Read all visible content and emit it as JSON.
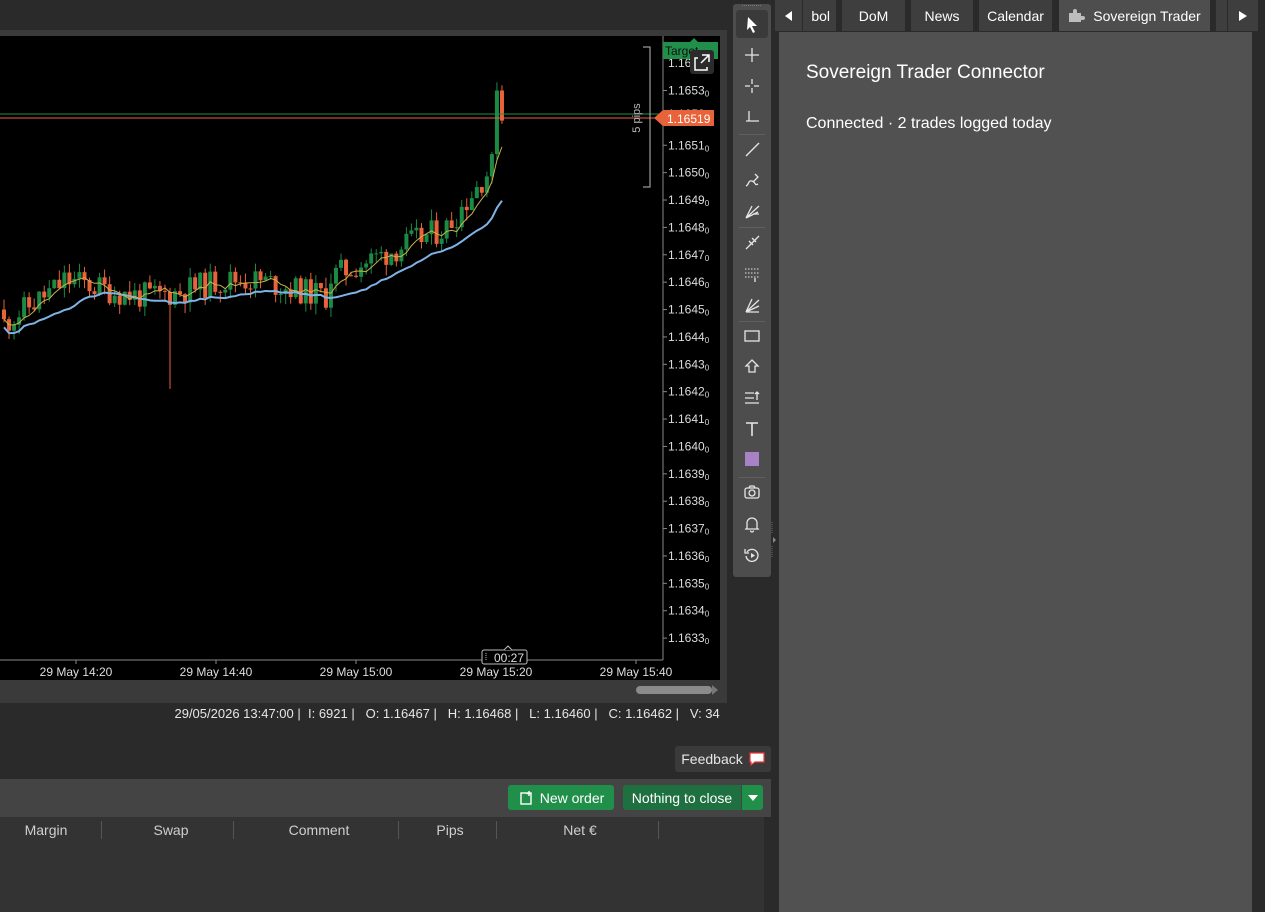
{
  "chart": {
    "price_labels": [
      "1.1653",
      "1.1652",
      "1.1651",
      "1.1650",
      "1.1649",
      "1.1648",
      "1.1647",
      "1.1646",
      "1.1645",
      "1.1644",
      "1.1643",
      "1.1642",
      "1.1641",
      "1.1640",
      "1.1639",
      "1.1638",
      "1.1637",
      "1.1636",
      "1.1635",
      "1.1634",
      "1.1633"
    ],
    "price_label_suffix": "0",
    "time_labels": [
      "29 May 14:20",
      "29 May 14:40",
      "29 May 15:00",
      "29 May 15:20",
      "29 May 15:40"
    ],
    "current_price": "1.16519",
    "target_label": "Target",
    "target_price_partial": "1.1652",
    "top_price_partial": "1.165",
    "range_label": "5 pips",
    "countdown": "00:27",
    "colors": {
      "bull": "#1b8a44",
      "bear": "#e8623a",
      "ma_fast": "#7fb3e8",
      "ma_slow": "#c8b44a",
      "target": "#1f8f4a",
      "current": "#e8623a"
    }
  },
  "ohlc": {
    "datetime": "29/05/2026 13:47:00",
    "ticks": "I: 6921",
    "open": "O: 1.16467",
    "high": "H: 1.16468",
    "low": "L: 1.16460",
    "close": "C: 1.16462",
    "volume": "V: 34"
  },
  "feedback": {
    "label": "Feedback"
  },
  "orders": {
    "new_order": "New order",
    "close_all": "Nothing to close",
    "columns": [
      "Margin",
      "Swap",
      "Comment",
      "Pips",
      "Net €"
    ]
  },
  "toolbar": {
    "tools": [
      "pointer-icon",
      "crosshair-icon",
      "zoom-crosshair-icon",
      "measure-icon",
      "line-icon",
      "pen-icon",
      "fib-fan-icon",
      "pitchfork-icon",
      "fib-retracement-icon",
      "fan-icon",
      "rectangle-icon",
      "arrow-up-icon",
      "levels-icon",
      "text-icon",
      "color-swatch-icon",
      "camera-icon",
      "alert-bell-icon",
      "replay-icon"
    ]
  },
  "tabs": {
    "items": [
      {
        "label": "bol"
      },
      {
        "label": "DoM"
      },
      {
        "label": "News"
      },
      {
        "label": "Calendar"
      },
      {
        "label": "Sovereign Trader"
      }
    ]
  },
  "panel": {
    "title": "Sovereign Trader Connector",
    "status": "Connected · 2 trades logged today"
  }
}
